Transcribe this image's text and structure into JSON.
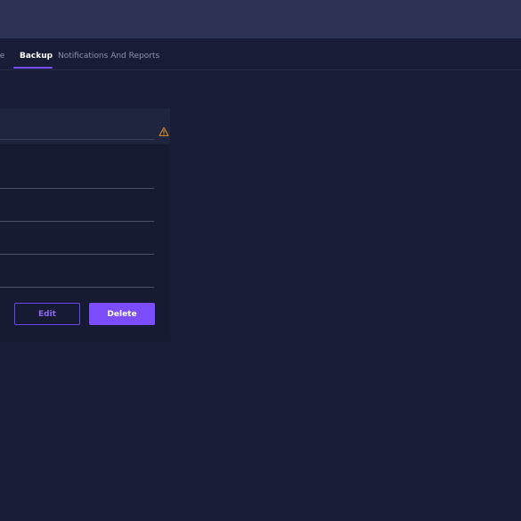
{
  "tabs": {
    "prev_partial_label": "ge",
    "active_label": "Backup",
    "next_label": "Notifications And Reports"
  },
  "panel": {
    "actions": {
      "edit_label": "Edit",
      "delete_label": "Delete"
    },
    "header_icon": "warning-icon"
  },
  "colors": {
    "accent": "#7c4dff",
    "background": "#181c37",
    "topbar": "#2d3354",
    "warning": "#e0922a"
  }
}
